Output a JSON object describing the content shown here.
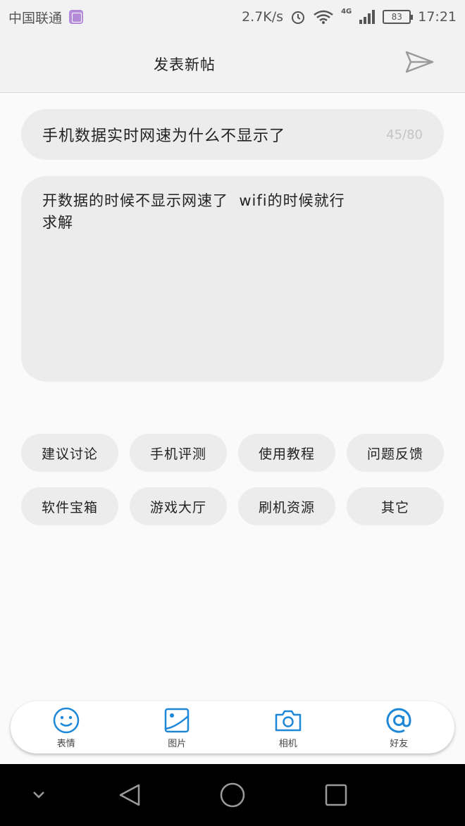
{
  "status_bar": {
    "carrier": "中国联通",
    "speed": "2.7K/s",
    "network_type": "4G",
    "battery": "83",
    "time": "17:21"
  },
  "header": {
    "title": "发表新帖",
    "send_icon": "send-icon"
  },
  "post": {
    "title": "手机数据实时网速为什么不显示了",
    "title_count": "45/80",
    "body": "开数据的时候不显示网速了  wifi的时候就行\n求解"
  },
  "tags": [
    {
      "label": "建议讨论"
    },
    {
      "label": "手机评测"
    },
    {
      "label": "使用教程"
    },
    {
      "label": "问题反馈"
    },
    {
      "label": "软件宝箱"
    },
    {
      "label": "游戏大厅"
    },
    {
      "label": "刷机资源"
    },
    {
      "label": "其它"
    }
  ],
  "toolbar": {
    "items": [
      {
        "label": "表情",
        "icon": "emoji-icon"
      },
      {
        "label": "图片",
        "icon": "image-icon"
      },
      {
        "label": "相机",
        "icon": "camera-icon"
      },
      {
        "label": "好友",
        "icon": "at-icon"
      }
    ],
    "accent_color": "#1e88d8"
  },
  "nav_bar": {
    "icons": [
      "chevron-down-icon",
      "back-triangle-icon",
      "home-circle-icon",
      "recents-square-icon"
    ]
  }
}
